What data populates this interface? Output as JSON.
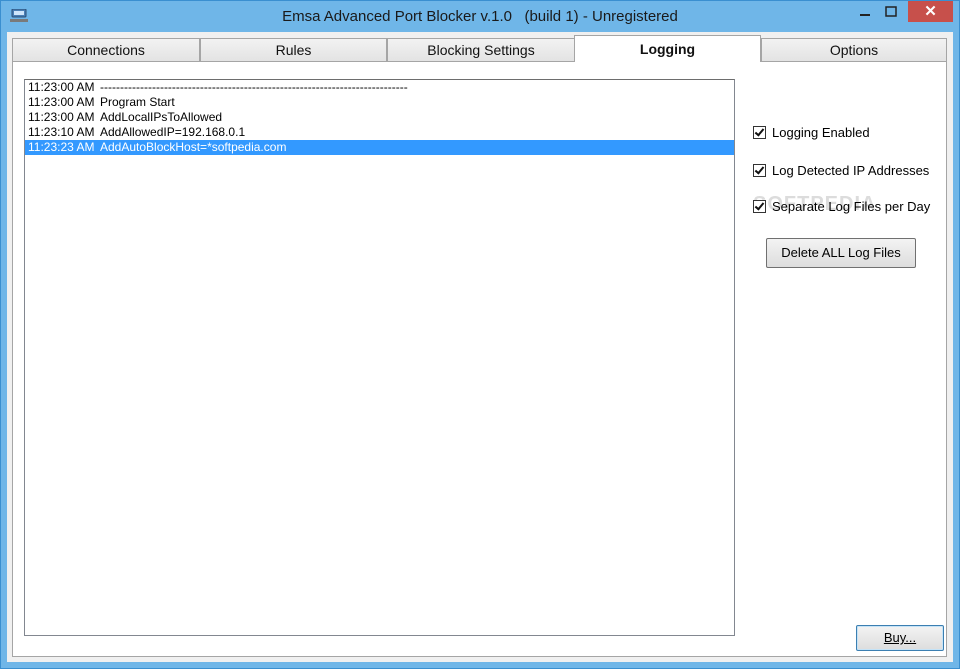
{
  "window": {
    "title": "Emsa Advanced Port Blocker v.1.0   (build 1) - Unregistered",
    "close_label": "✕"
  },
  "tabs": [
    {
      "label": "Connections"
    },
    {
      "label": "Rules"
    },
    {
      "label": "Blocking Settings"
    },
    {
      "label": "Logging"
    },
    {
      "label": "Options"
    }
  ],
  "active_tab": "Logging",
  "log": [
    {
      "time": "11:23:00 AM",
      "message": "-----------------------------------------------------------------------------"
    },
    {
      "time": "11:23:00 AM",
      "message": "Program Start"
    },
    {
      "time": "11:23:00 AM",
      "message": "AddLocalIPsToAllowed"
    },
    {
      "time": "11:23:10 AM",
      "message": "AddAllowedIP=192.168.0.1"
    },
    {
      "time": "11:23:23 AM",
      "message": "AddAutoBlockHost=*softpedia.com",
      "selected": true
    }
  ],
  "options": {
    "logging_enabled": {
      "label": "Logging Enabled",
      "checked": true
    },
    "log_detected_ip": {
      "label": "Log Detected IP Addresses",
      "checked": true
    },
    "separate_log_files": {
      "label": "Separate Log Files per Day",
      "checked": true
    }
  },
  "buttons": {
    "delete_all": "Delete ALL Log Files",
    "buy": "Buy..."
  },
  "watermark": "SOFTPEDIA"
}
